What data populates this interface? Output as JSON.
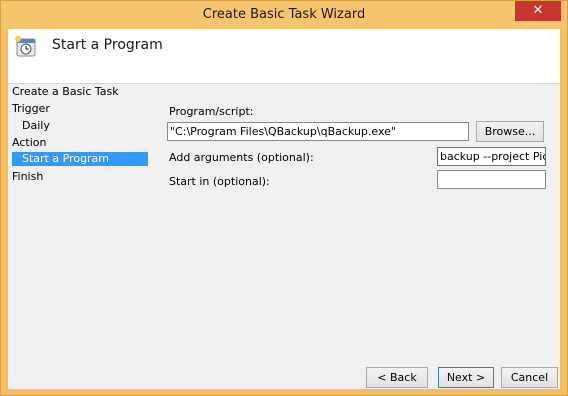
{
  "window": {
    "title": "Create Basic Task Wizard",
    "close_glyph": "✕"
  },
  "header": {
    "title": "Start a Program",
    "icon": "task-scheduler-clock-icon"
  },
  "steps": {
    "items": [
      {
        "label": "Create a Basic Task",
        "selected": false
      },
      {
        "label": "Trigger",
        "selected": false
      },
      {
        "label": "Daily",
        "selected": false
      },
      {
        "label": "Action",
        "selected": false
      },
      {
        "label": "Start a Program",
        "selected": true
      },
      {
        "label": "Finish",
        "selected": false
      }
    ]
  },
  "form": {
    "program_label": "Program/script:",
    "program_value": "\"C:\\Program Files\\QBackup\\qBackup.exe\"",
    "browse_label": "Browse...",
    "arguments_label": "Add arguments (optional):",
    "arguments_value": "backup --project Picture",
    "start_in_label": "Start in (optional):",
    "start_in_value": ""
  },
  "buttons": {
    "back": "< Back",
    "next": "Next >",
    "cancel": "Cancel"
  },
  "colors": {
    "titlebar": "#f5c56d",
    "close": "#c7372f",
    "selection": "#3399ff",
    "client": "#f0f0f0"
  }
}
